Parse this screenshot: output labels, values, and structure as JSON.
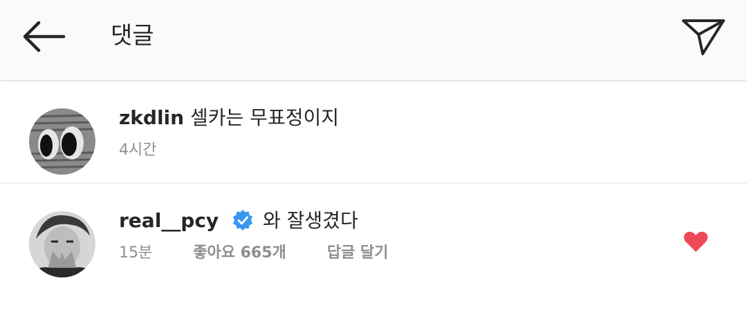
{
  "header": {
    "title": "댓글",
    "back_icon": "arrow-left-icon",
    "share_icon": "paper-plane-icon"
  },
  "comments": [
    {
      "username": "zkdlin",
      "text": "셀카는 무표정이지",
      "time": "4시간",
      "verified": false
    },
    {
      "username": "real__pcy",
      "verified": true,
      "text": "와 잘생겼다",
      "time": "15분",
      "likes": "좋아요 665개",
      "reply": "답글 달기",
      "liked": true
    }
  ],
  "colors": {
    "verified_blue": "#3897f0",
    "heart_red": "#ed4956",
    "meta_gray": "#8e8e8e",
    "header_bg": "#fafafa"
  }
}
